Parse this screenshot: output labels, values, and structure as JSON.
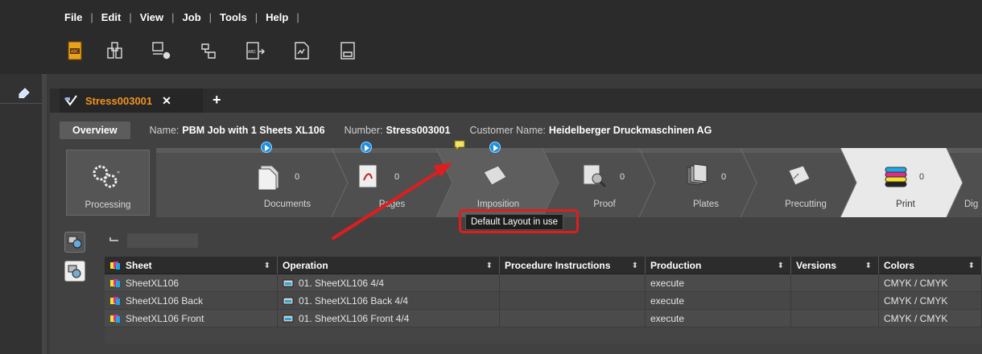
{
  "menu": [
    "File",
    "Edit",
    "View",
    "Job",
    "Tools",
    "Help"
  ],
  "toolbar_icons": [
    "abc-document-icon",
    "split-document-icon",
    "person-settings-icon",
    "merge-icon",
    "abc-arrow-icon",
    "signed-document-icon",
    "imposition-sheet-icon"
  ],
  "tab": {
    "title": "Stress003001",
    "close": "✕",
    "add": "+"
  },
  "info": {
    "overview": "Overview",
    "name_label": "Name:",
    "name_value": "PBM Job with 1 Sheets XL106",
    "number_label": "Number:",
    "number_value": "Stress003001",
    "customer_label": "Customer Name:",
    "customer_value": "Heidelberger Druckmaschinen AG"
  },
  "processing": {
    "label": "Processing"
  },
  "steps": [
    {
      "label": "Documents",
      "count": "0",
      "icon": "documents-icon"
    },
    {
      "label": "Pages",
      "count": "0",
      "icon": "pdf-pages-icon"
    },
    {
      "label": "Imposition",
      "count": "",
      "icon": "imposition-icon"
    },
    {
      "label": "Proof",
      "count": "0",
      "icon": "proof-icon"
    },
    {
      "label": "Plates",
      "count": "0",
      "icon": "plates-icon"
    },
    {
      "label": "Precutting",
      "count": "",
      "icon": "precutting-icon"
    },
    {
      "label": "Print",
      "count": "0",
      "icon": "print-icon"
    },
    {
      "label": "Dig",
      "count": "",
      "icon": "digital-icon"
    }
  ],
  "tooltip": "Default Layout in use",
  "table": {
    "headers": [
      "Sheet",
      "Operation",
      "Procedure Instructions",
      "Production",
      "Versions",
      "Colors"
    ],
    "rows": [
      {
        "sheet": "SheetXL106",
        "operation": "01. SheetXL106 4/4",
        "procedure": "",
        "production": "execute",
        "versions": "",
        "colors": "CMYK / CMYK"
      },
      {
        "sheet": "SheetXL106 Back",
        "operation": "01. SheetXL106 Back 4/4",
        "procedure": "",
        "production": "execute",
        "versions": "",
        "colors": "CMYK / CMYK"
      },
      {
        "sheet": "SheetXL106 Front",
        "operation": "01. SheetXL106 Front 4/4",
        "procedure": "",
        "production": "execute",
        "versions": "",
        "colors": "CMYK / CMYK"
      }
    ]
  },
  "colors": {
    "accent_orange": "#f2931f",
    "highlight_red": "#e01d1d",
    "play_blue": "#1b8fe0"
  }
}
